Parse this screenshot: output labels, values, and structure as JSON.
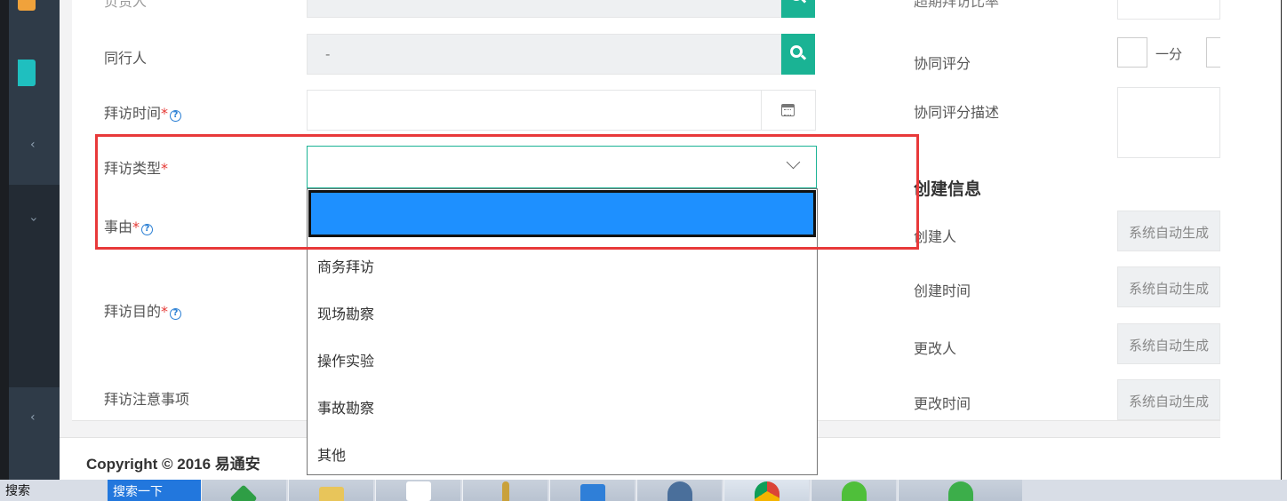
{
  "form": {
    "field_top_partial": "负责人",
    "companion_label": "同行人",
    "companion_value": "-",
    "visit_time_label": "拜访时间",
    "visit_type_label": "拜访类型",
    "reason_label": "事由",
    "purpose_label": "拜访目的",
    "notes_label": "拜访注意事项",
    "required_mark": "*",
    "help_mark": "?"
  },
  "dropdown": {
    "options": [
      "商务拜访",
      "现场勘察",
      "操作实验",
      "事故勘察",
      "其他"
    ]
  },
  "right": {
    "top_partial_label": "超期拜访比率",
    "coop_score_label": "协同评分",
    "coop_score_unit": "一分",
    "coop_desc_label": "协同评分描述",
    "section_title": "创建信息",
    "creator_label": "创建人",
    "created_time_label": "创建时间",
    "modifier_label": "更改人",
    "modified_time_label": "更改时间",
    "auto_value": "系统自动生成"
  },
  "footer": {
    "copyright": "Copyright © 2016 易通安"
  },
  "taskbar": {
    "search_text": "搜索",
    "search_button": "搜索一下"
  },
  "colors": {
    "accent": "#1ab394",
    "highlight": "#1e90ff",
    "annotation": "#e8393a",
    "sidebar": "#2f3b48"
  }
}
